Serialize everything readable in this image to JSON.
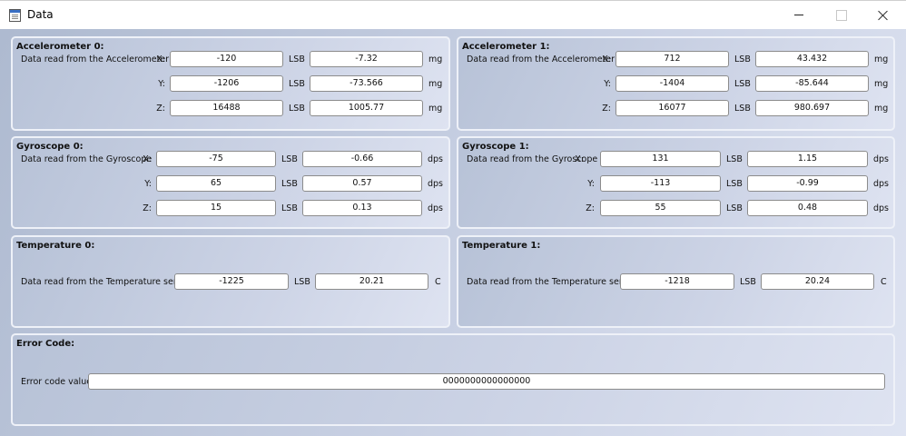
{
  "window": {
    "title": "Data"
  },
  "accelerometers": [
    {
      "title": "Accelerometer 0:",
      "desc": "Data read from the Accelerometer",
      "rows": [
        {
          "axis": "X:",
          "raw": "-120",
          "unit_raw": "LSB",
          "val": "-7.32",
          "unit": "mg"
        },
        {
          "axis": "Y:",
          "raw": "-1206",
          "unit_raw": "LSB",
          "val": "-73.566",
          "unit": "mg"
        },
        {
          "axis": "Z:",
          "raw": "16488",
          "unit_raw": "LSB",
          "val": "1005.77",
          "unit": "mg"
        }
      ]
    },
    {
      "title": "Accelerometer 1:",
      "desc": "Data read from the Accelerometer",
      "rows": [
        {
          "axis": "X:",
          "raw": "712",
          "unit_raw": "LSB",
          "val": "43.432",
          "unit": "mg"
        },
        {
          "axis": "Y:",
          "raw": "-1404",
          "unit_raw": "LSB",
          "val": "-85.644",
          "unit": "mg"
        },
        {
          "axis": "Z:",
          "raw": "16077",
          "unit_raw": "LSB",
          "val": "980.697",
          "unit": "mg"
        }
      ]
    }
  ],
  "gyroscopes": [
    {
      "title": "Gyroscope 0:",
      "desc": "Data read from the Gyroscope",
      "rows": [
        {
          "axis": "X:",
          "raw": "-75",
          "unit_raw": "LSB",
          "val": "-0.66",
          "unit": "dps"
        },
        {
          "axis": "Y:",
          "raw": "65",
          "unit_raw": "LSB",
          "val": "0.57",
          "unit": "dps"
        },
        {
          "axis": "Z:",
          "raw": "15",
          "unit_raw": "LSB",
          "val": "0.13",
          "unit": "dps"
        }
      ]
    },
    {
      "title": "Gyroscope 1:",
      "desc": "Data read from the Gyroscope",
      "rows": [
        {
          "axis": "X:",
          "raw": "131",
          "unit_raw": "LSB",
          "val": "1.15",
          "unit": "dps"
        },
        {
          "axis": "Y:",
          "raw": "-113",
          "unit_raw": "LSB",
          "val": "-0.99",
          "unit": "dps"
        },
        {
          "axis": "Z:",
          "raw": "55",
          "unit_raw": "LSB",
          "val": "0.48",
          "unit": "dps"
        }
      ]
    }
  ],
  "temperatures": [
    {
      "title": "Temperature 0:",
      "desc": "Data read from the Temperature sensor",
      "raw": "-1225",
      "unit_raw": "LSB",
      "val": "20.21",
      "unit": "C"
    },
    {
      "title": "Temperature 1:",
      "desc": "Data read from the Temperature sensor",
      "raw": "-1218",
      "unit_raw": "LSB",
      "val": "20.24",
      "unit": "C"
    }
  ],
  "error": {
    "title": "Error Code:",
    "label": "Error code value",
    "value": "0000000000000000"
  }
}
